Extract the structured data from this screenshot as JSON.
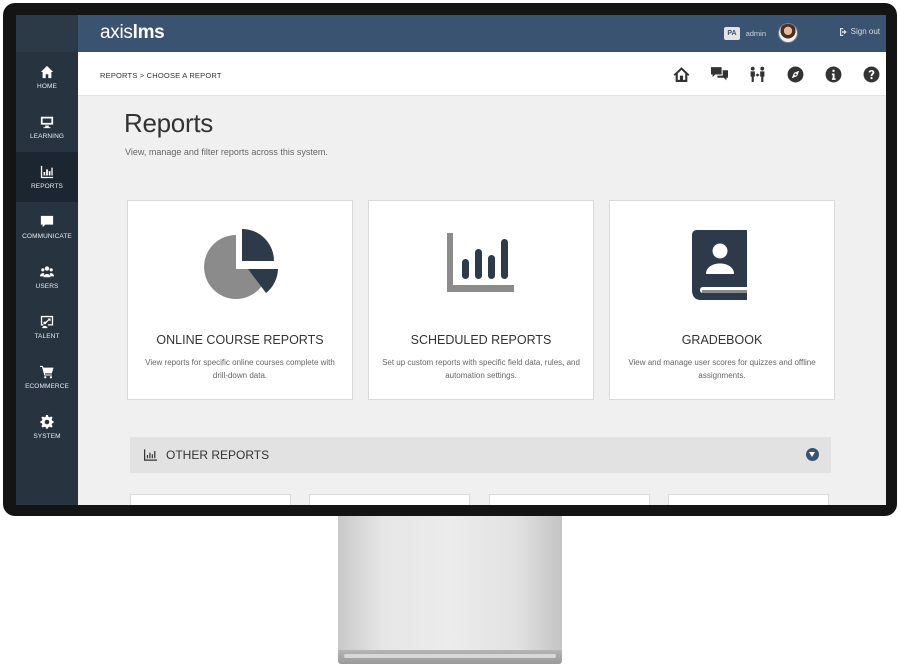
{
  "app": {
    "brand_light": "axis",
    "brand_bold": "lms"
  },
  "header": {
    "initials": "PA",
    "user_name": "admin",
    "signout_label": "Sign out"
  },
  "breadcrumb": "REPORTS > CHOOSE A REPORT",
  "sidebar": {
    "items": [
      {
        "label": "HOME",
        "icon": "home-icon"
      },
      {
        "label": "LEARNING",
        "icon": "monitor-icon"
      },
      {
        "label": "REPORTS",
        "icon": "bar-chart-icon",
        "active": true
      },
      {
        "label": "COMMUNICATE",
        "icon": "chat-icon"
      },
      {
        "label": "USERS",
        "icon": "users-icon"
      },
      {
        "label": "TALENT",
        "icon": "talent-icon"
      },
      {
        "label": "ECOMMERCE",
        "icon": "cart-icon"
      },
      {
        "label": "SYSTEM",
        "icon": "gear-icon"
      }
    ]
  },
  "toolbar_icons": [
    "home-icon",
    "chat-icon",
    "people-icon",
    "compass-icon",
    "info-icon",
    "help-icon"
  ],
  "page": {
    "title": "Reports",
    "subtitle": "View, manage and filter reports across this system."
  },
  "cards": [
    {
      "title": "ONLINE COURSE REPORTS",
      "desc": "View reports for specific online courses complete with drill-down data.",
      "icon": "pie-chart-icon"
    },
    {
      "title": "SCHEDULED REPORTS",
      "desc": "Set up custom reports with specific field data, rules, and automation settings.",
      "icon": "bar-chart-icon"
    },
    {
      "title": "GRADEBOOK",
      "desc": "View and manage user scores for quizzes and offline assignments.",
      "icon": "gradebook-icon"
    }
  ],
  "other_reports": {
    "label": "OTHER REPORTS",
    "expanded": false
  },
  "colors": {
    "topbar": "#3a5370",
    "sidebar": "#27333f",
    "accent": "#3a5370"
  }
}
